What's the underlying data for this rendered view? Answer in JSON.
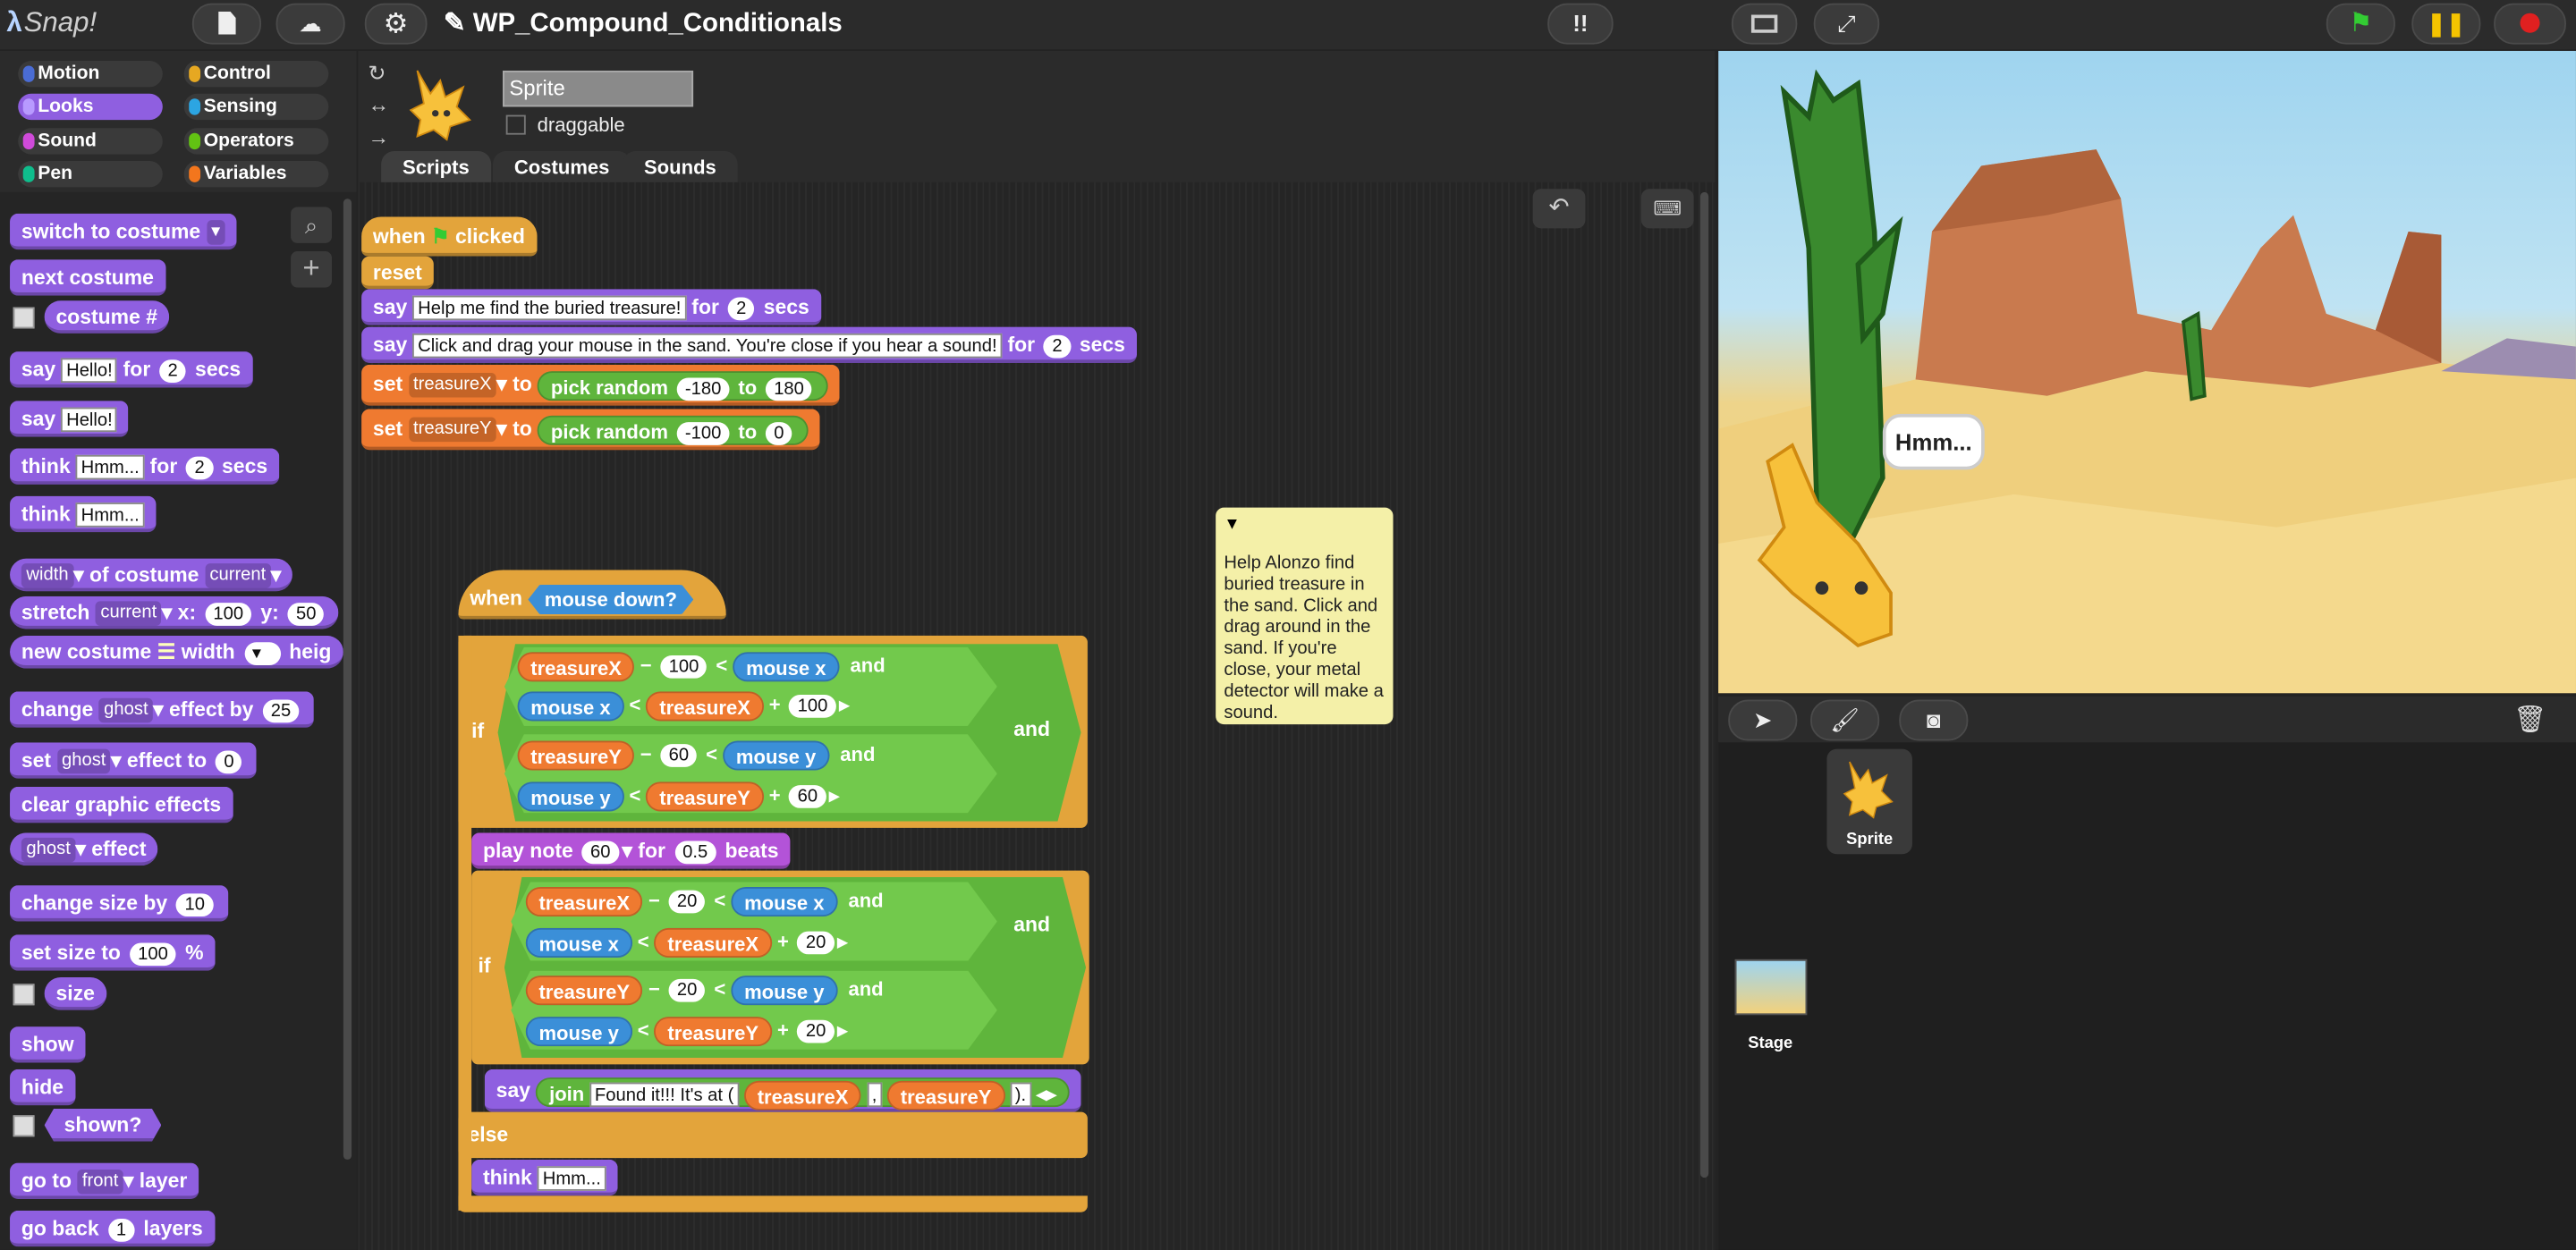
{
  "app": {
    "logo": "Snap!",
    "project_title": "WP_Compound_Conditionals"
  },
  "toolbar": {
    "file_label": "☰",
    "cloud_label": "☁",
    "settings_label": "⚙",
    "edit_icon": "✎"
  },
  "categories": [
    "Motion",
    "Control",
    "Looks",
    "Sensing",
    "Sound",
    "Operators",
    "Pen",
    "Variables"
  ],
  "category_colors": [
    "#4a6cd4",
    "#e6a822",
    "#8f5fe0",
    "#2ca5e2",
    "#cf4ad9",
    "#62c213",
    "#0fbd8c",
    "#f3761d"
  ],
  "palette": {
    "switch_costume": "switch to costume",
    "next_costume": "next costume",
    "costume_num": "costume #",
    "say_for": {
      "a": "say",
      "b": "Hello!",
      "c": "for",
      "d": "2",
      "e": "secs"
    },
    "say": {
      "a": "say",
      "b": "Hello!"
    },
    "think_for": {
      "a": "think",
      "b": "Hmm...",
      "c": "for",
      "d": "2",
      "e": "secs"
    },
    "think": {
      "a": "think",
      "b": "Hmm..."
    },
    "width_of": {
      "a": "width",
      "b": "of costume",
      "c": "current"
    },
    "stretch": {
      "a": "stretch",
      "b": "current",
      "c": "x:",
      "d": "100",
      "e": "y:",
      "f": "50"
    },
    "new_costume": {
      "a": "new costume",
      "b": "width",
      "c": "heig"
    },
    "change_effect": {
      "a": "change",
      "b": "ghost",
      "c": "effect by",
      "d": "25"
    },
    "set_effect": {
      "a": "set",
      "b": "ghost",
      "c": "effect to",
      "d": "0"
    },
    "clear_effects": "clear graphic effects",
    "ghost_effect": {
      "a": "ghost",
      "b": "effect"
    },
    "change_size": {
      "a": "change size by",
      "b": "10"
    },
    "set_size": {
      "a": "set size to",
      "b": "100",
      "c": "%"
    },
    "size": "size",
    "show": "show",
    "hide": "hide",
    "shown": "shown?",
    "go_to_layer": {
      "a": "go to",
      "b": "front",
      "c": "layer"
    },
    "go_back": {
      "a": "go back",
      "b": "1",
      "c": "layers"
    }
  },
  "sprite": {
    "name": "Sprite",
    "draggable": "draggable"
  },
  "tabs": [
    "Scripts",
    "Costumes",
    "Sounds"
  ],
  "script1": {
    "hat": {
      "a": "when",
      "b": "clicked"
    },
    "reset": "reset",
    "say1": {
      "a": "say",
      "b": "Help me find the buried treasure!",
      "c": "for",
      "d": "2",
      "e": "secs"
    },
    "say2": {
      "a": "say",
      "b": "Click and drag your mouse in the sand. You're close if you hear a sound!",
      "c": "for",
      "d": "2",
      "e": "secs"
    },
    "setx": {
      "a": "set",
      "b": "treasureX",
      "c": "to",
      "d": "pick random",
      "e": "-180",
      "f": "to",
      "g": "180"
    },
    "sety": {
      "a": "set",
      "b": "treasureY",
      "c": "to",
      "d": "pick random",
      "e": "-100",
      "f": "to",
      "g": "0"
    }
  },
  "script2": {
    "hat": {
      "a": "when",
      "b": "mouse down?"
    },
    "if1": "if",
    "c1": {
      "a": "treasureX",
      "b": "−",
      "c": "100",
      "d": "<",
      "e": "mouse x",
      "f": "and"
    },
    "c2": {
      "a": "mouse x",
      "b": "<",
      "c": "treasureX",
      "d": "+",
      "e": "100"
    },
    "c3": {
      "a": "treasureY",
      "b": "−",
      "c": "60",
      "d": "<",
      "e": "mouse y",
      "f": "and"
    },
    "c4": {
      "a": "mouse y",
      "b": "<",
      "c": "treasureY",
      "d": "+",
      "e": "60"
    },
    "and_outer": "and",
    "play": {
      "a": "play note",
      "b": "60",
      "c": "for",
      "d": "0.5",
      "e": "beats"
    },
    "if2": "if",
    "d1": {
      "a": "treasureX",
      "b": "−",
      "c": "20",
      "d": "<",
      "e": "mouse x",
      "f": "and"
    },
    "d2": {
      "a": "mouse x",
      "b": "<",
      "c": "treasureX",
      "d": "+",
      "e": "20"
    },
    "d3": {
      "a": "treasureY",
      "b": "−",
      "c": "20",
      "d": "<",
      "e": "mouse y",
      "f": "and"
    },
    "d4": {
      "a": "mouse y",
      "b": "<",
      "c": "treasureY",
      "d": "+",
      "e": "20"
    },
    "and_outer2": "and",
    "say": {
      "a": "say",
      "b": "join",
      "c": "Found it!!! It's at (",
      "d": "treasureX",
      "e": ",",
      "f": "treasureY",
      "g": ")."
    },
    "else": "else",
    "think": {
      "a": "think",
      "b": "Hmm..."
    }
  },
  "comment": "Help Alonzo find buried treasure in the sand. Click and drag around in the sand. If you're close, your metal detector will make a sound.",
  "stage": {
    "bubble": "Hmm..."
  },
  "corral": {
    "sprite_label": "Sprite",
    "stage_label": "Stage"
  }
}
